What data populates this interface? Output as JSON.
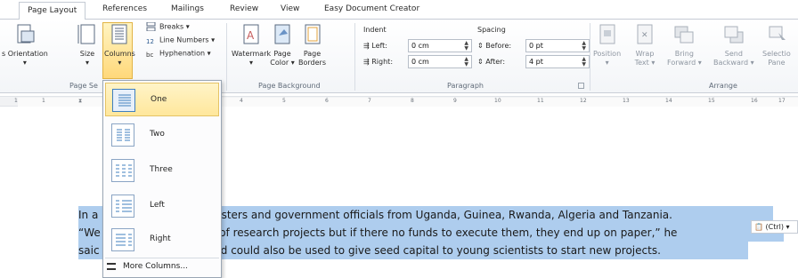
{
  "tabs": [
    "Page Layout",
    "References",
    "Mailings",
    "Review",
    "View",
    "Easy Document Creator"
  ],
  "ribbon": {
    "page_setup": {
      "orientation": "s Orientation",
      "size": "Size",
      "columns": "Columns",
      "breaks": "Breaks",
      "line_numbers": "Line Numbers",
      "hyphenation": "Hyphenation",
      "group_label": "Page Se"
    },
    "page_background": {
      "watermark": "Watermark",
      "page_color_1": "Page",
      "page_color_2": "Color",
      "page_borders_1": "Page",
      "page_borders_2": "Borders",
      "group_label": "Page Background"
    },
    "paragraph": {
      "indent_title": "Indent",
      "left_label": "Left:",
      "left_value": "0 cm",
      "right_label": "Right:",
      "right_value": "0 cm",
      "spacing_title": "Spacing",
      "before_label": "Before:",
      "before_value": "0 pt",
      "after_label": "After:",
      "after_value": "4 pt",
      "group_label": "Paragraph"
    },
    "arrange": {
      "position": "Position",
      "wrap_1": "Wrap",
      "wrap_2": "Text",
      "bring_1": "Bring",
      "bring_2": "Forward",
      "send_1": "Send",
      "send_2": "Backward",
      "selection_1": "Selectio",
      "selection_2": "Pane",
      "group_label": "Arrange"
    }
  },
  "ruler_numbers": [
    "1",
    "1",
    "4",
    "5",
    "6",
    "7",
    "8",
    "9",
    "10",
    "11",
    "12",
    "13",
    "14",
    "15",
    "16",
    "17"
  ],
  "columns_menu": {
    "items": [
      "One",
      "Two",
      "Three",
      "Left",
      "Right"
    ],
    "more": "More Columns...",
    "selected": "One"
  },
  "document": {
    "lines": [
      [
        "In a",
        "inisters and government officials from Uganda, Guinea, Rwanda, Algeria and Tanzania."
      ],
      [
        "“We",
        "es of research projects but if there no funds to execute them, they end up on paper,” he"
      ],
      [
        "saic",
        "und could also be used to give seed capital to young scientists  to start new projects."
      ]
    ]
  },
  "paste_options": "(Ctrl)",
  "colors": {
    "selection": "#aecdee",
    "accent": "#3f7fbf",
    "highlight": "#ffd87a"
  }
}
